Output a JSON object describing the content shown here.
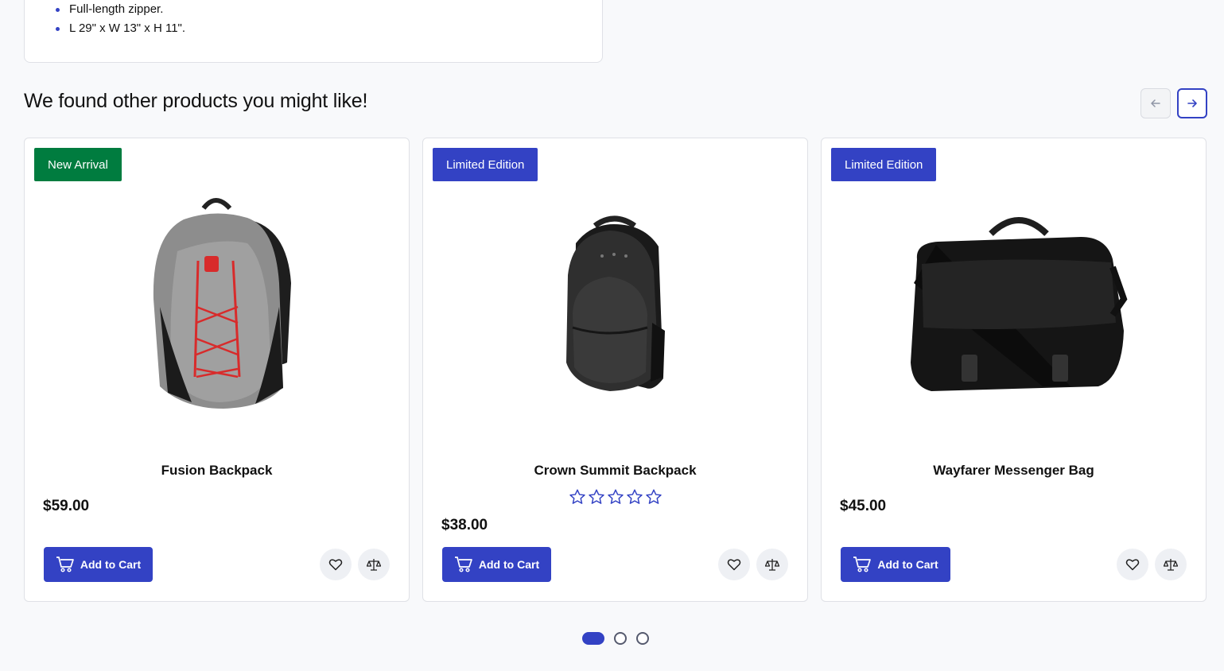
{
  "details": {
    "items": [
      "Full-length zipper.",
      "L 29\" x W 13\" x H 11\"."
    ]
  },
  "recommendations": {
    "title": "We found other products you might like!",
    "prev_icon": "arrow-left-icon",
    "next_icon": "arrow-right-icon",
    "products": [
      {
        "badge": "New Arrival",
        "badge_color": "#007c3f",
        "name": "Fusion Backpack",
        "price": "$59.00",
        "rating": null,
        "add_to_cart": "Add to Cart",
        "image": "gray-red-backpack"
      },
      {
        "badge": "Limited Edition",
        "badge_color": "#3342c4",
        "name": "Crown Summit Backpack",
        "price": "$38.00",
        "rating": 0,
        "add_to_cart": "Add to Cart",
        "image": "black-backpack"
      },
      {
        "badge": "Limited Edition",
        "badge_color": "#3342c4",
        "name": "Wayfarer Messenger Bag",
        "price": "$45.00",
        "rating": null,
        "add_to_cart": "Add to Cart",
        "image": "black-messenger-bag"
      }
    ]
  },
  "pagination": {
    "pages": 3,
    "current": 1
  },
  "colors": {
    "accent": "#3342c4",
    "new_arrival": "#007c3f",
    "background": "#f8f9fb"
  }
}
